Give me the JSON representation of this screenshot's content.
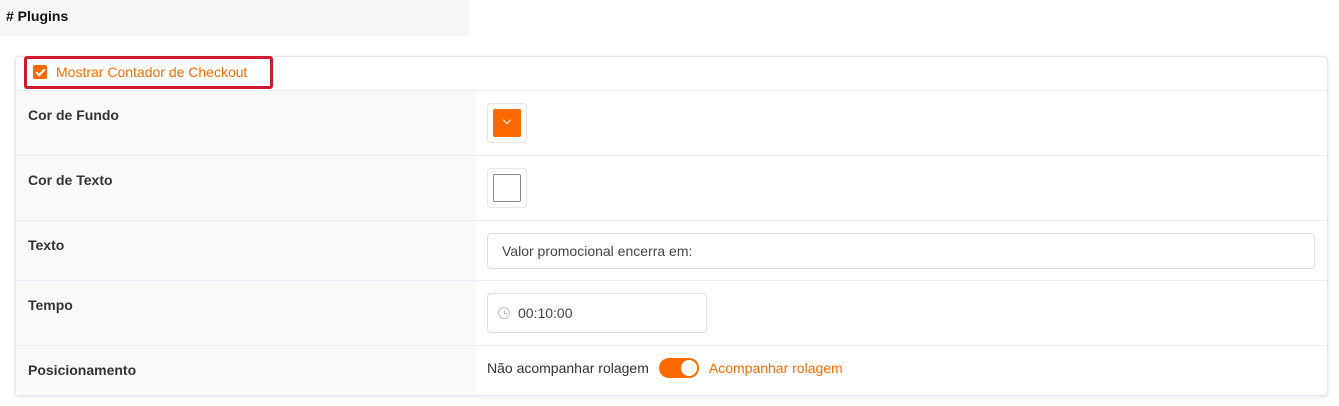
{
  "section": {
    "title": "# Plugins"
  },
  "plugin": {
    "checkbox_label": "Mostrar Contador de Checkout",
    "checked": true
  },
  "rows": {
    "background_color": {
      "label": "Cor de Fundo",
      "value": "#ff6a00"
    },
    "text_color": {
      "label": "Cor de Texto",
      "value": "#ffffff"
    },
    "text": {
      "label": "Texto",
      "value": "Valor promocional encerra em:"
    },
    "time": {
      "label": "Tempo",
      "value": "00:10:00"
    },
    "positioning": {
      "label": "Posicionamento",
      "off_label": "Não acompanhar rolagem",
      "on_label": "Acompanhar rolagem",
      "enabled": true
    }
  },
  "colors": {
    "accent": "#ff6a00",
    "highlight": "#d0192f"
  }
}
